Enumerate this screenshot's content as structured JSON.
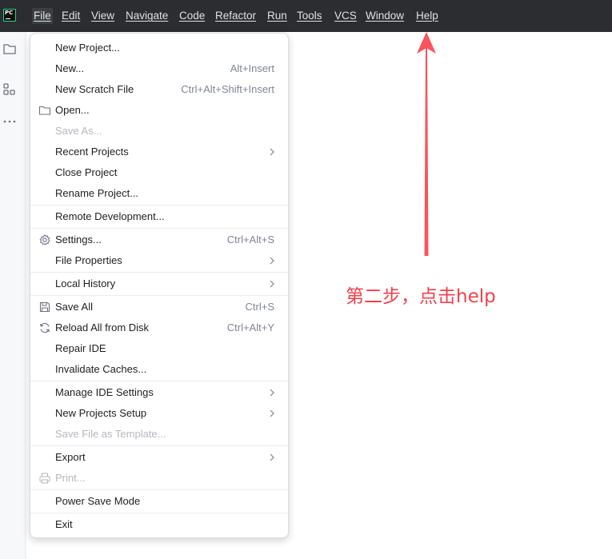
{
  "app": {
    "logo_text": "PC",
    "accent_color": "#21d789"
  },
  "menubar": {
    "items": [
      "File",
      "Edit",
      "View",
      "Navigate",
      "Code",
      "Refactor",
      "Run",
      "Tools",
      "VCS",
      "Window",
      "Help"
    ],
    "active_item": "File"
  },
  "left_toolbar": {
    "icons": [
      "folder-icon",
      "structure-icon",
      "more-icon"
    ]
  },
  "file_menu": {
    "items": [
      {
        "label": "New Project...",
        "shortcut": "",
        "icon": "",
        "submenu": false,
        "disabled": false
      },
      {
        "label": "New...",
        "shortcut": "Alt+Insert",
        "icon": "",
        "submenu": false,
        "disabled": false
      },
      {
        "label": "New Scratch File",
        "shortcut": "Ctrl+Alt+Shift+Insert",
        "icon": "",
        "submenu": false,
        "disabled": false
      },
      {
        "label": "Open...",
        "shortcut": "",
        "icon": "folder-icon",
        "submenu": false,
        "disabled": false
      },
      {
        "label": "Save As...",
        "shortcut": "",
        "icon": "",
        "submenu": false,
        "disabled": true
      },
      {
        "label": "Recent Projects",
        "shortcut": "",
        "icon": "",
        "submenu": true,
        "disabled": false
      },
      {
        "label": "Close Project",
        "shortcut": "",
        "icon": "",
        "submenu": false,
        "disabled": false
      },
      {
        "label": "Rename Project...",
        "shortcut": "",
        "icon": "",
        "submenu": false,
        "disabled": false
      },
      {
        "label": "Remote Development...",
        "shortcut": "",
        "icon": "",
        "submenu": false,
        "disabled": false
      },
      {
        "label": "Settings...",
        "shortcut": "Ctrl+Alt+S",
        "icon": "gear-icon",
        "submenu": false,
        "disabled": false
      },
      {
        "label": "File Properties",
        "shortcut": "",
        "icon": "",
        "submenu": true,
        "disabled": false
      },
      {
        "label": "Local History",
        "shortcut": "",
        "icon": "",
        "submenu": true,
        "disabled": false
      },
      {
        "label": "Save All",
        "shortcut": "Ctrl+S",
        "icon": "save-icon",
        "submenu": false,
        "disabled": false
      },
      {
        "label": "Reload All from Disk",
        "shortcut": "Ctrl+Alt+Y",
        "icon": "reload-icon",
        "submenu": false,
        "disabled": false
      },
      {
        "label": "Repair IDE",
        "shortcut": "",
        "icon": "",
        "submenu": false,
        "disabled": false
      },
      {
        "label": "Invalidate Caches...",
        "shortcut": "",
        "icon": "",
        "submenu": false,
        "disabled": false
      },
      {
        "label": "Manage IDE Settings",
        "shortcut": "",
        "icon": "",
        "submenu": true,
        "disabled": false
      },
      {
        "label": "New Projects Setup",
        "shortcut": "",
        "icon": "",
        "submenu": true,
        "disabled": false
      },
      {
        "label": "Save File as Template...",
        "shortcut": "",
        "icon": "",
        "submenu": false,
        "disabled": true
      },
      {
        "label": "Export",
        "shortcut": "",
        "icon": "",
        "submenu": true,
        "disabled": false
      },
      {
        "label": "Print...",
        "shortcut": "",
        "icon": "print-icon",
        "submenu": false,
        "disabled": true
      },
      {
        "label": "Power Save Mode",
        "shortcut": "",
        "icon": "",
        "submenu": false,
        "disabled": false
      },
      {
        "label": "Exit",
        "shortcut": "",
        "icon": "",
        "submenu": false,
        "disabled": false
      }
    ]
  },
  "annotation": {
    "text": "第二步，点击help",
    "color": "#f0414b"
  }
}
